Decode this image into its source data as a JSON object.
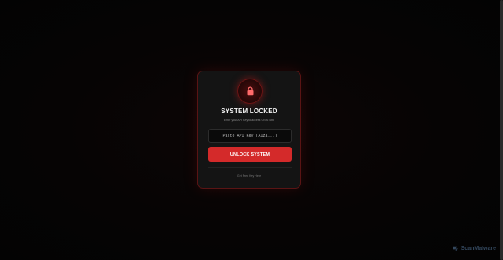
{
  "lock_screen": {
    "title": "SYSTEM LOCKED",
    "subtitle": "Enter your API Key to access GrowTube",
    "api_key_input": {
      "value": "",
      "placeholder": "Paste API Key (AIza...)"
    },
    "unlock_button_label": "UNLOCK SYSTEM",
    "free_key_link_label": "Get Free Key Here",
    "icon": "lock-icon"
  },
  "watermark": {
    "text": "ScanMalware",
    "icon": "scanmalware-logo-icon"
  },
  "colors": {
    "accent": "#d42a2a",
    "card_border": "#5a1414",
    "card_background": "#141414",
    "page_background": "#050505"
  }
}
